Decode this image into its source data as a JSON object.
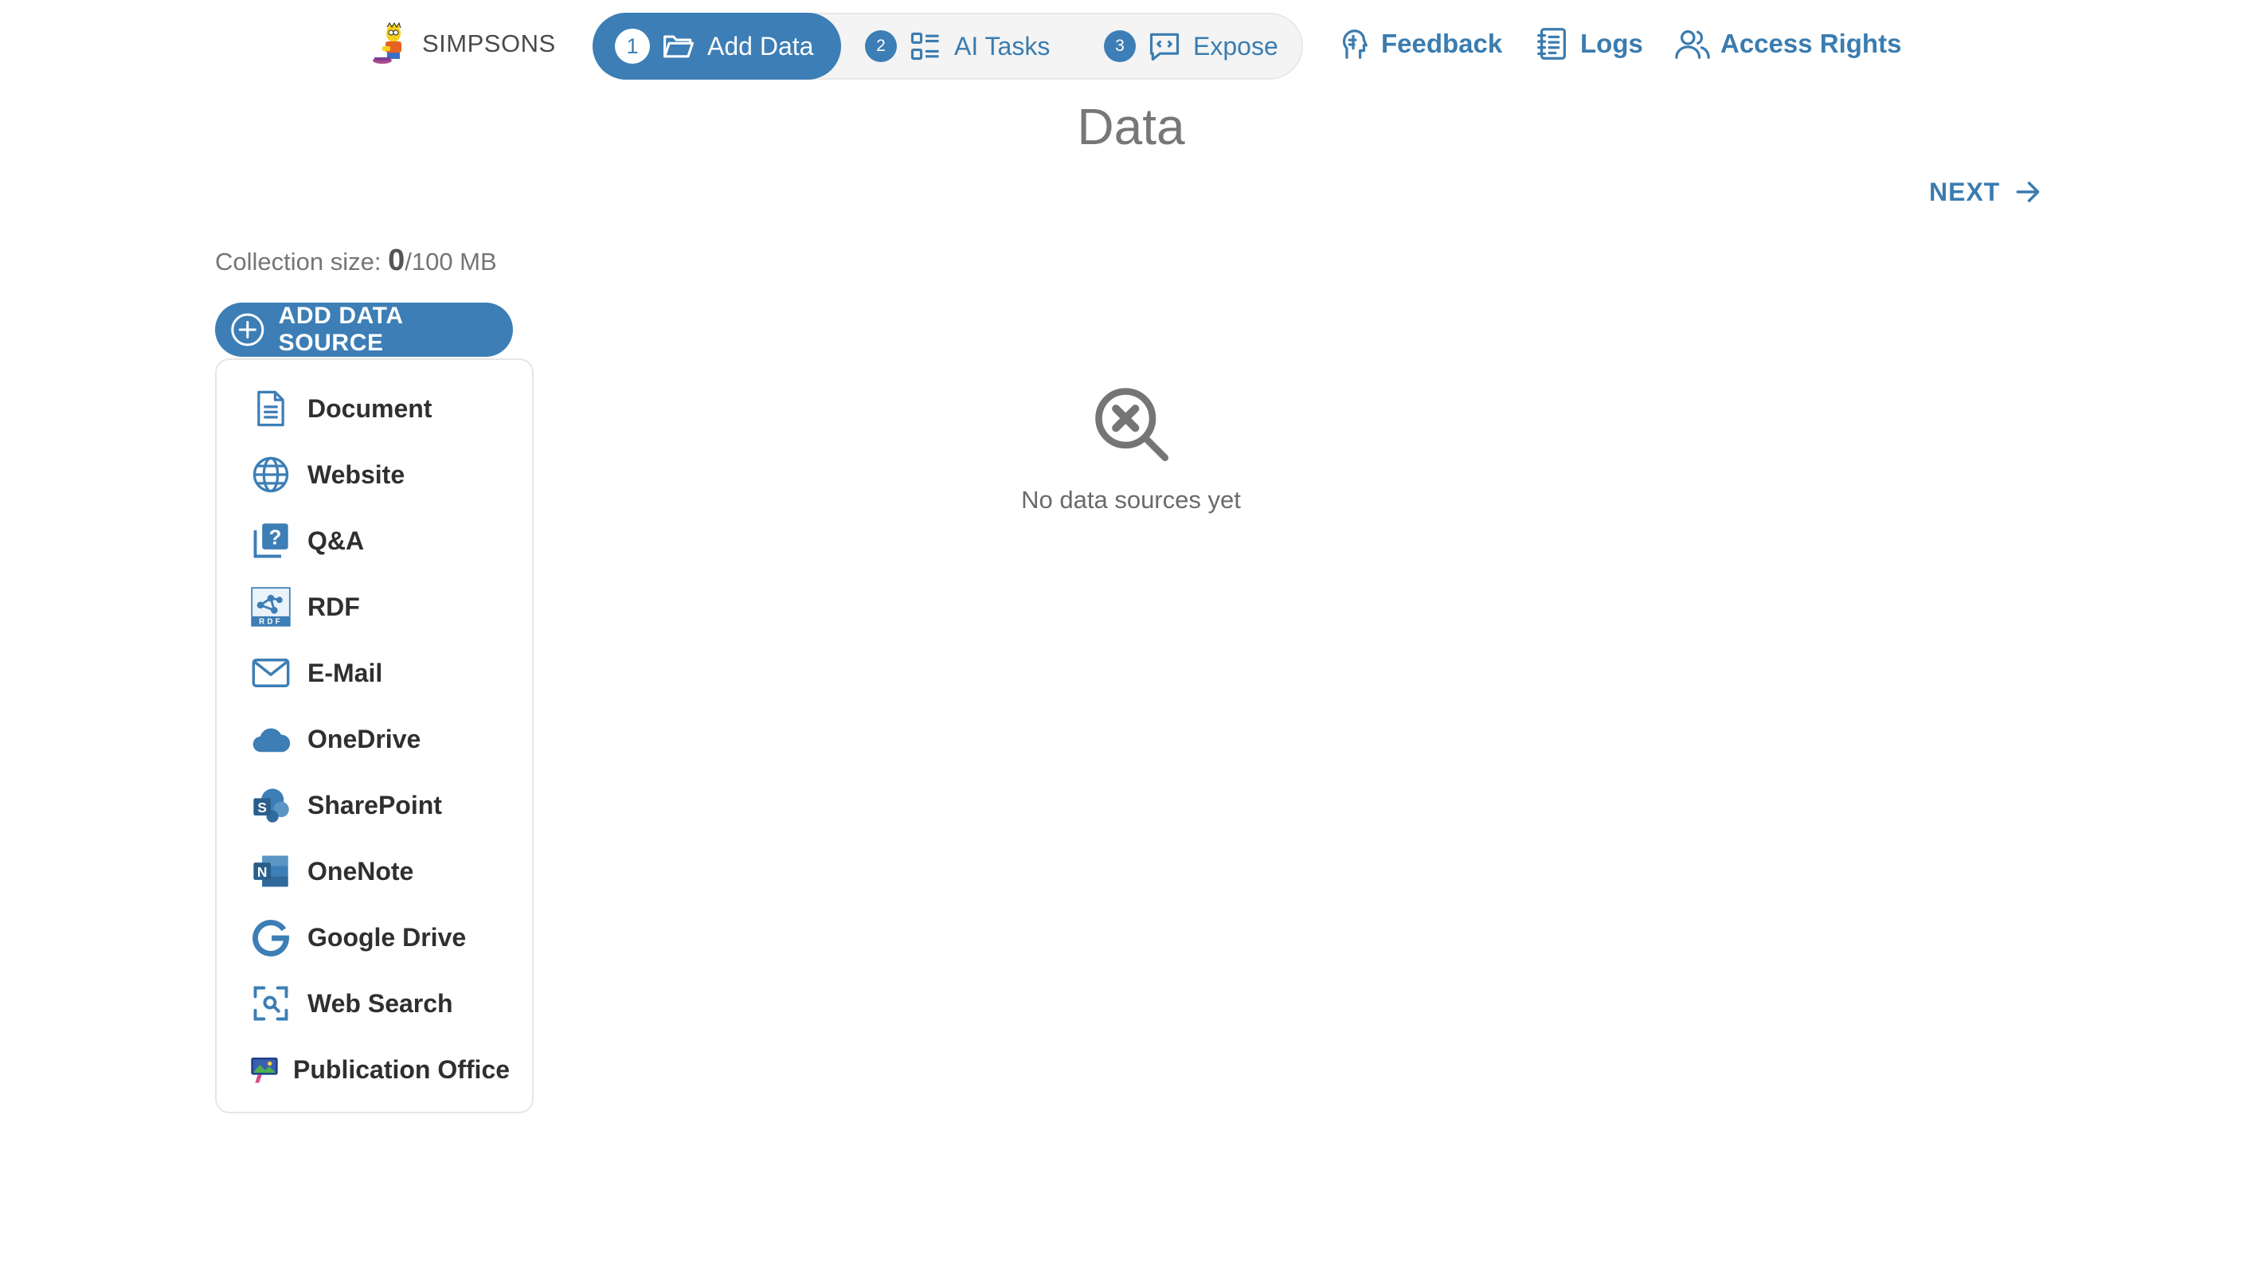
{
  "brand": {
    "name": "SIMPSONS",
    "logo_icon": "simpsons-character-logo"
  },
  "stepper": [
    {
      "number": "1",
      "label": "Add Data",
      "icon": "folder-open-icon",
      "active": true
    },
    {
      "number": "2",
      "label": "AI Tasks",
      "icon": "task-list-icon",
      "active": false
    },
    {
      "number": "3",
      "label": "Expose",
      "icon": "code-chat-icon",
      "active": false
    }
  ],
  "nav": {
    "feedback": "Feedback",
    "logs": "Logs",
    "access_rights": "Access Rights"
  },
  "page": {
    "title": "Data",
    "next_label": "NEXT",
    "collection_label": "Collection size: ",
    "collection_used": "0",
    "collection_total": "/100 MB",
    "add_source_label": "ADD DATA SOURCE"
  },
  "sources": [
    {
      "label": "Document",
      "icon": "document-icon"
    },
    {
      "label": "Website",
      "icon": "globe-icon"
    },
    {
      "label": "Q&A",
      "icon": "question-icon"
    },
    {
      "label": "RDF",
      "icon": "rdf-icon"
    },
    {
      "label": "E-Mail",
      "icon": "mail-icon"
    },
    {
      "label": "OneDrive",
      "icon": "cloud-icon"
    },
    {
      "label": "SharePoint",
      "icon": "sharepoint-icon"
    },
    {
      "label": "OneNote",
      "icon": "onenote-icon"
    },
    {
      "label": "Google Drive",
      "icon": "google-icon"
    },
    {
      "label": "Web Search",
      "icon": "web-search-icon"
    },
    {
      "label": "Publication Office",
      "icon": "publication-office-icon"
    }
  ],
  "empty_state": {
    "message": "No data sources yet",
    "icon": "search-cancel-icon"
  },
  "colors": {
    "accent": "#3c7eb5",
    "text": "#2f2f2f",
    "muted": "#777777"
  }
}
